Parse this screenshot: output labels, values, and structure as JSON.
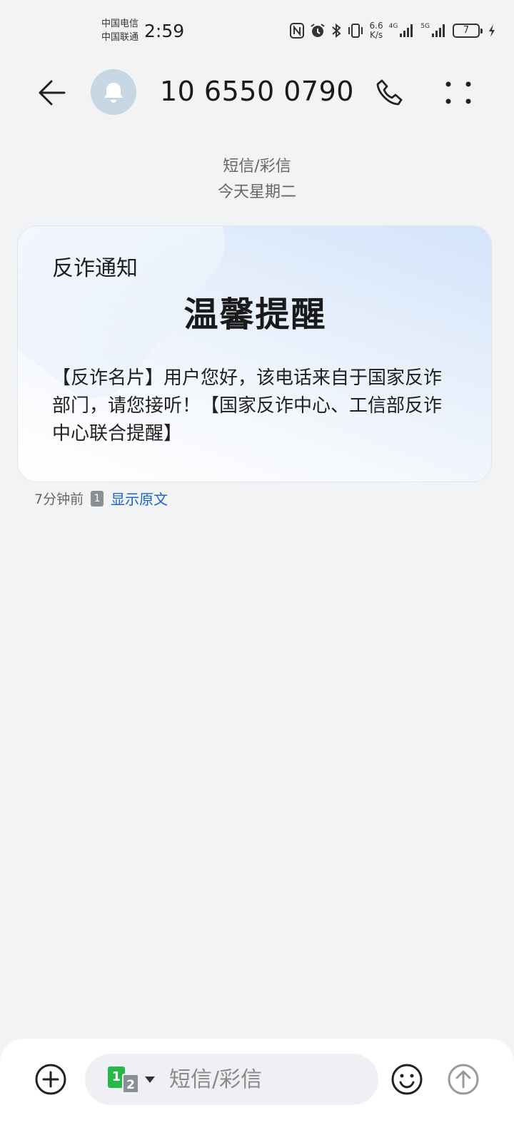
{
  "status_bar": {
    "carrier_1": "中国电信",
    "carrier_2": "中国联通",
    "time": "2:59",
    "net_speed_value": "6.6",
    "net_speed_unit": "K/s",
    "sim1_network": "4G",
    "sim2_network": "5G",
    "battery_level": "7"
  },
  "header": {
    "contact_number": "10 6550 0790"
  },
  "conversation": {
    "channel": "短信/彩信",
    "date": "今天星期二"
  },
  "message": {
    "tag": "反诈通知",
    "title": "温馨提醒",
    "body": "【反诈名片】用户您好，该电话来自于国家反诈部门，请您接听！【国家反诈中心、工信部反诈中心联合提醒】",
    "time_ago": "7分钟前",
    "sim_slot": "1",
    "show_original_label": "显示原文"
  },
  "input_bar": {
    "sim_primary": "1",
    "sim_secondary": "2",
    "placeholder": "短信/彩信"
  }
}
